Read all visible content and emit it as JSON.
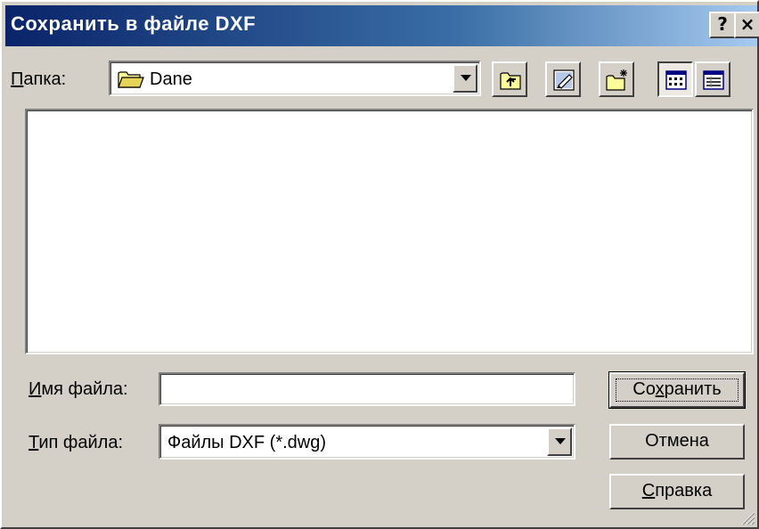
{
  "title": "Сохранить в файле DXF",
  "titlebar": {
    "help": "?",
    "close": "×"
  },
  "folder": {
    "label_u": "П",
    "label_rest": "апка:",
    "value": "Dane"
  },
  "filename": {
    "label_u": "И",
    "label_rest": "мя файла:",
    "value": ""
  },
  "filetype": {
    "label_u": "Т",
    "label_rest": "ип файла:",
    "value": "Файлы DXF (*.dwg)"
  },
  "buttons": {
    "save_pre": "Со",
    "save_u": "х",
    "save_post": "ранить",
    "cancel": "Отмена",
    "help_u": "С",
    "help_rest": "правка"
  },
  "icons": [
    "folder-icon",
    "up-folder-icon",
    "desktop-icon",
    "new-folder-icon",
    "list-view-icon",
    "details-view-icon",
    "chevron-down-icon",
    "resize-grip-icon"
  ],
  "colors": {
    "title_start": "#0a246a",
    "title_end": "#a6caf0",
    "face": "#d4d0c8"
  }
}
